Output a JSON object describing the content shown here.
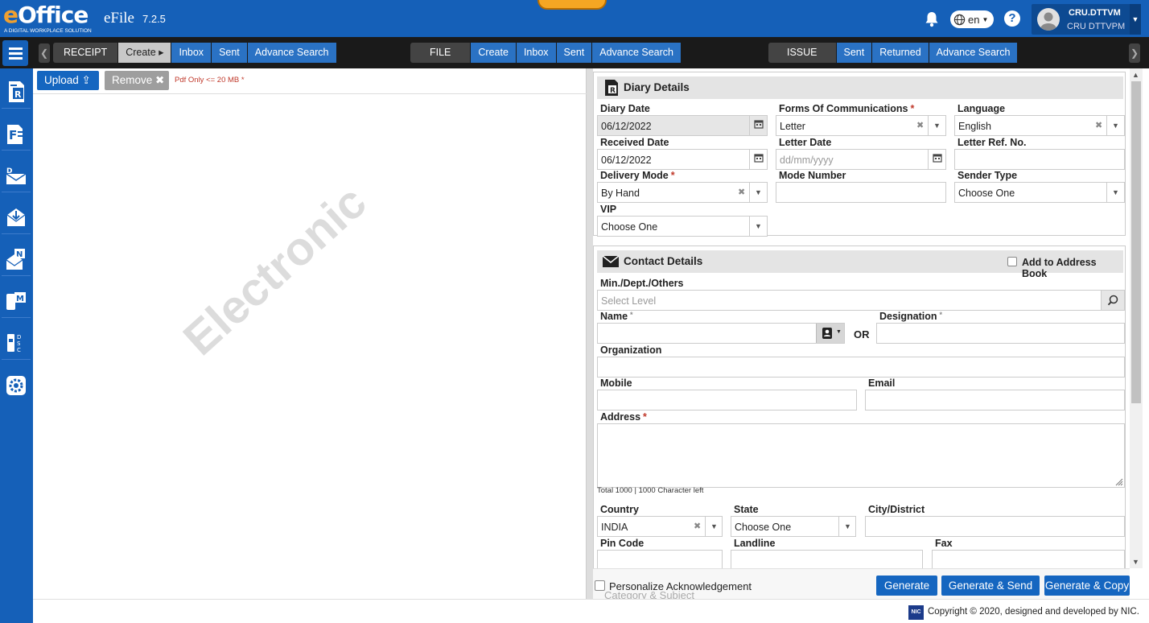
{
  "header": {
    "logo_main": "eOffice",
    "logo_tagline": "A DIGITAL WORKPLACE SOLUTION",
    "app_name": "eFile",
    "app_version": "7.2.5",
    "language": "en",
    "help": "?",
    "user_id": "CRU.DTTVM",
    "user_desc": "CRU DTTVPM"
  },
  "nav": {
    "receipt": {
      "label": "RECEIPT",
      "items": [
        "Create",
        "Inbox",
        "Sent",
        "Advance Search"
      ]
    },
    "file": {
      "label": "FILE",
      "items": [
        "Create",
        "Inbox",
        "Sent",
        "Advance Search"
      ]
    },
    "issue": {
      "label": "ISSUE",
      "items": [
        "Sent",
        "Returned",
        "Advance Search"
      ]
    }
  },
  "sidebar": {
    "items": [
      "receipt-icon",
      "file-icon",
      "dak-icon",
      "inbox-download-icon",
      "notification-icon",
      "mobile-icon",
      "dsc-icon",
      "settings-icon"
    ]
  },
  "upload": {
    "upload_label": "Upload",
    "remove_label": "Remove",
    "note": "Pdf Only <= 20 MB *",
    "watermark": "Electronic"
  },
  "diary": {
    "title": "Diary Details",
    "diary_date": {
      "label": "Diary Date",
      "value": "06/12/2022"
    },
    "forms": {
      "label": "Forms Of Communications",
      "value": "Letter"
    },
    "language": {
      "label": "Language",
      "value": "English"
    },
    "received_date": {
      "label": "Received Date",
      "value": "06/12/2022"
    },
    "letter_date": {
      "label": "Letter Date",
      "placeholder": "dd/mm/yyyy"
    },
    "letter_ref": {
      "label": "Letter Ref. No.",
      "value": ""
    },
    "delivery_mode": {
      "label": "Delivery Mode",
      "value": "By Hand"
    },
    "mode_number": {
      "label": "Mode Number",
      "value": ""
    },
    "sender_type": {
      "label": "Sender Type",
      "value": "Choose One"
    },
    "vip": {
      "label": "VIP",
      "value": "Choose One"
    }
  },
  "contact": {
    "title": "Contact Details",
    "add_to_book": "Add to Address Book",
    "min_dept": {
      "label": "Min./Dept./Others",
      "placeholder": "Select Level"
    },
    "name": {
      "label": "Name",
      "value": ""
    },
    "or_label": "OR",
    "designation": {
      "label": "Designation",
      "value": ""
    },
    "organization": {
      "label": "Organization",
      "value": ""
    },
    "mobile": {
      "label": "Mobile",
      "value": ""
    },
    "email": {
      "label": "Email",
      "value": ""
    },
    "address": {
      "label": "Address",
      "value": "",
      "counter": "Total 1000 | 1000 Character left"
    },
    "country": {
      "label": "Country",
      "value": "INDIA"
    },
    "state": {
      "label": "State",
      "value": "Choose One"
    },
    "city": {
      "label": "City/District",
      "value": ""
    },
    "pin": {
      "label": "Pin Code",
      "value": ""
    },
    "landline": {
      "label": "Landline",
      "value": ""
    },
    "fax": {
      "label": "Fax",
      "value": ""
    }
  },
  "category_title": "Category & Subject",
  "bottom": {
    "personalize": "Personalize Acknowledgement",
    "generate": "Generate",
    "generate_send": "Generate & Send",
    "generate_copy": "Generate & Copy"
  },
  "footer": {
    "nic": "NIC",
    "copyright": "Copyright © 2020, designed and developed by NIC."
  },
  "colors": {
    "brand": "#1560b8",
    "button": "#1566c0",
    "required": "#c0392b"
  }
}
